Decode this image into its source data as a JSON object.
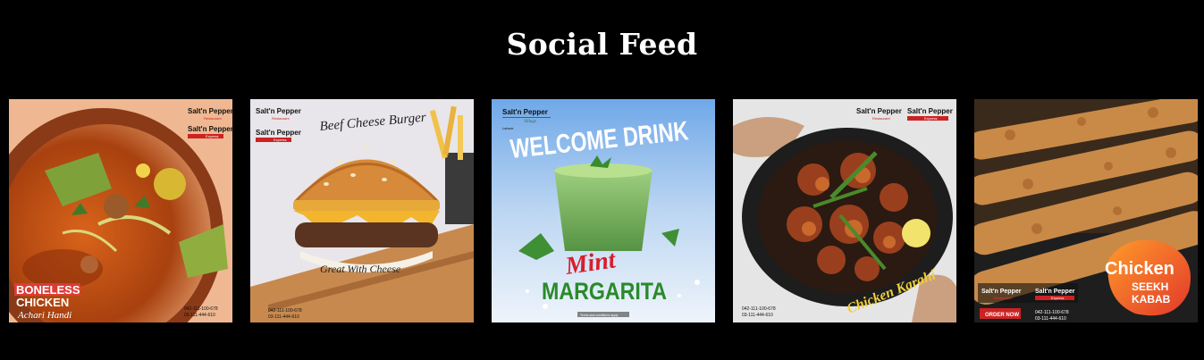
{
  "page": {
    "title": "Social Feed"
  },
  "posts": [
    {
      "brand_top": "Salt'n Pepper",
      "brand_sub": "Restaurant",
      "brand_top2": "Salt'n Pepper",
      "brand_sub2": "Express",
      "line1": "BONELESS",
      "line2": "CHICKEN",
      "line3": "Achari Handi",
      "phone1": "042-111-100-678",
      "phone2": "03-111-444-610"
    },
    {
      "brand_top": "Salt'n Pepper",
      "brand_sub": "Restaurant",
      "brand_top2": "Salt'n Pepper",
      "brand_sub2": "Express",
      "headline": "Beef Cheese Burger",
      "tagline": "Great With Cheese",
      "phone1": "042-111-100-678",
      "phone2": "03-111-444-610"
    },
    {
      "brand_top": "Salt'n Pepper",
      "brand_sub": "Village",
      "brand_city": "Lahore",
      "headline": "WELCOME DRINK",
      "line1": "Mint",
      "line2": "MARGARITA",
      "terms": "Terms and conditions apply"
    },
    {
      "brand_top": "Salt'n Pepper",
      "brand_sub": "Restaurant",
      "brand_top2": "Salt'n Pepper",
      "brand_sub2": "Express",
      "headline": "Chicken Karahi",
      "phone1": "042-111-100-678",
      "phone2": "03-111-444-610"
    },
    {
      "headline": "Chicken",
      "line1": "SEEKH",
      "line2": "KABAB",
      "brand_top": "Salt'n Pepper",
      "brand_sub": "Restaurant",
      "brand_top2": "Salt'n Pepper",
      "brand_sub2": "Express",
      "cta": "ORDER NOW",
      "phone1": "042-111-100-678",
      "phone2": "03-111-444-610"
    }
  ]
}
